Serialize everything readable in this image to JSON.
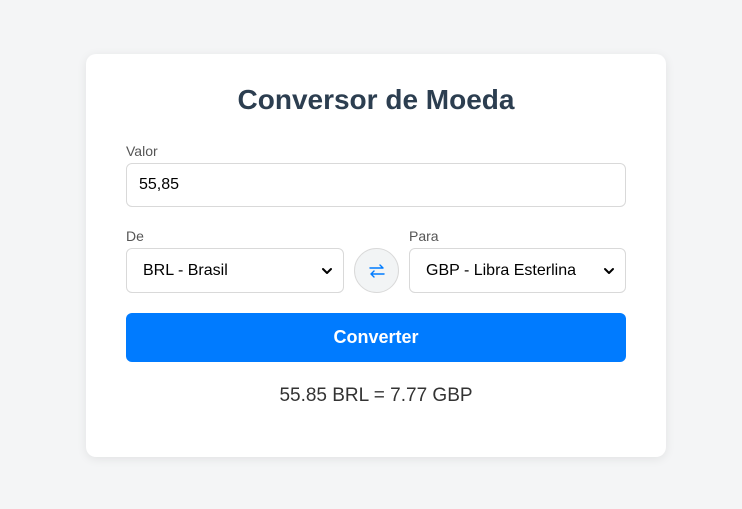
{
  "converter": {
    "title": "Conversor de Moeda",
    "amount_label": "Valor",
    "amount_value": "55,85",
    "from_label": "De",
    "from_selected": "BRL - Brasil",
    "to_label": "Para",
    "to_selected": "GBP - Libra Esterlina",
    "swap_icon": "swap-arrows-icon",
    "convert_label": "Converter",
    "result_text": "55.85 BRL = 7.77 GBP"
  },
  "colors": {
    "accent": "#007bff",
    "title": "#2c3e50",
    "background": "#f4f5f6",
    "card": "#ffffff"
  }
}
